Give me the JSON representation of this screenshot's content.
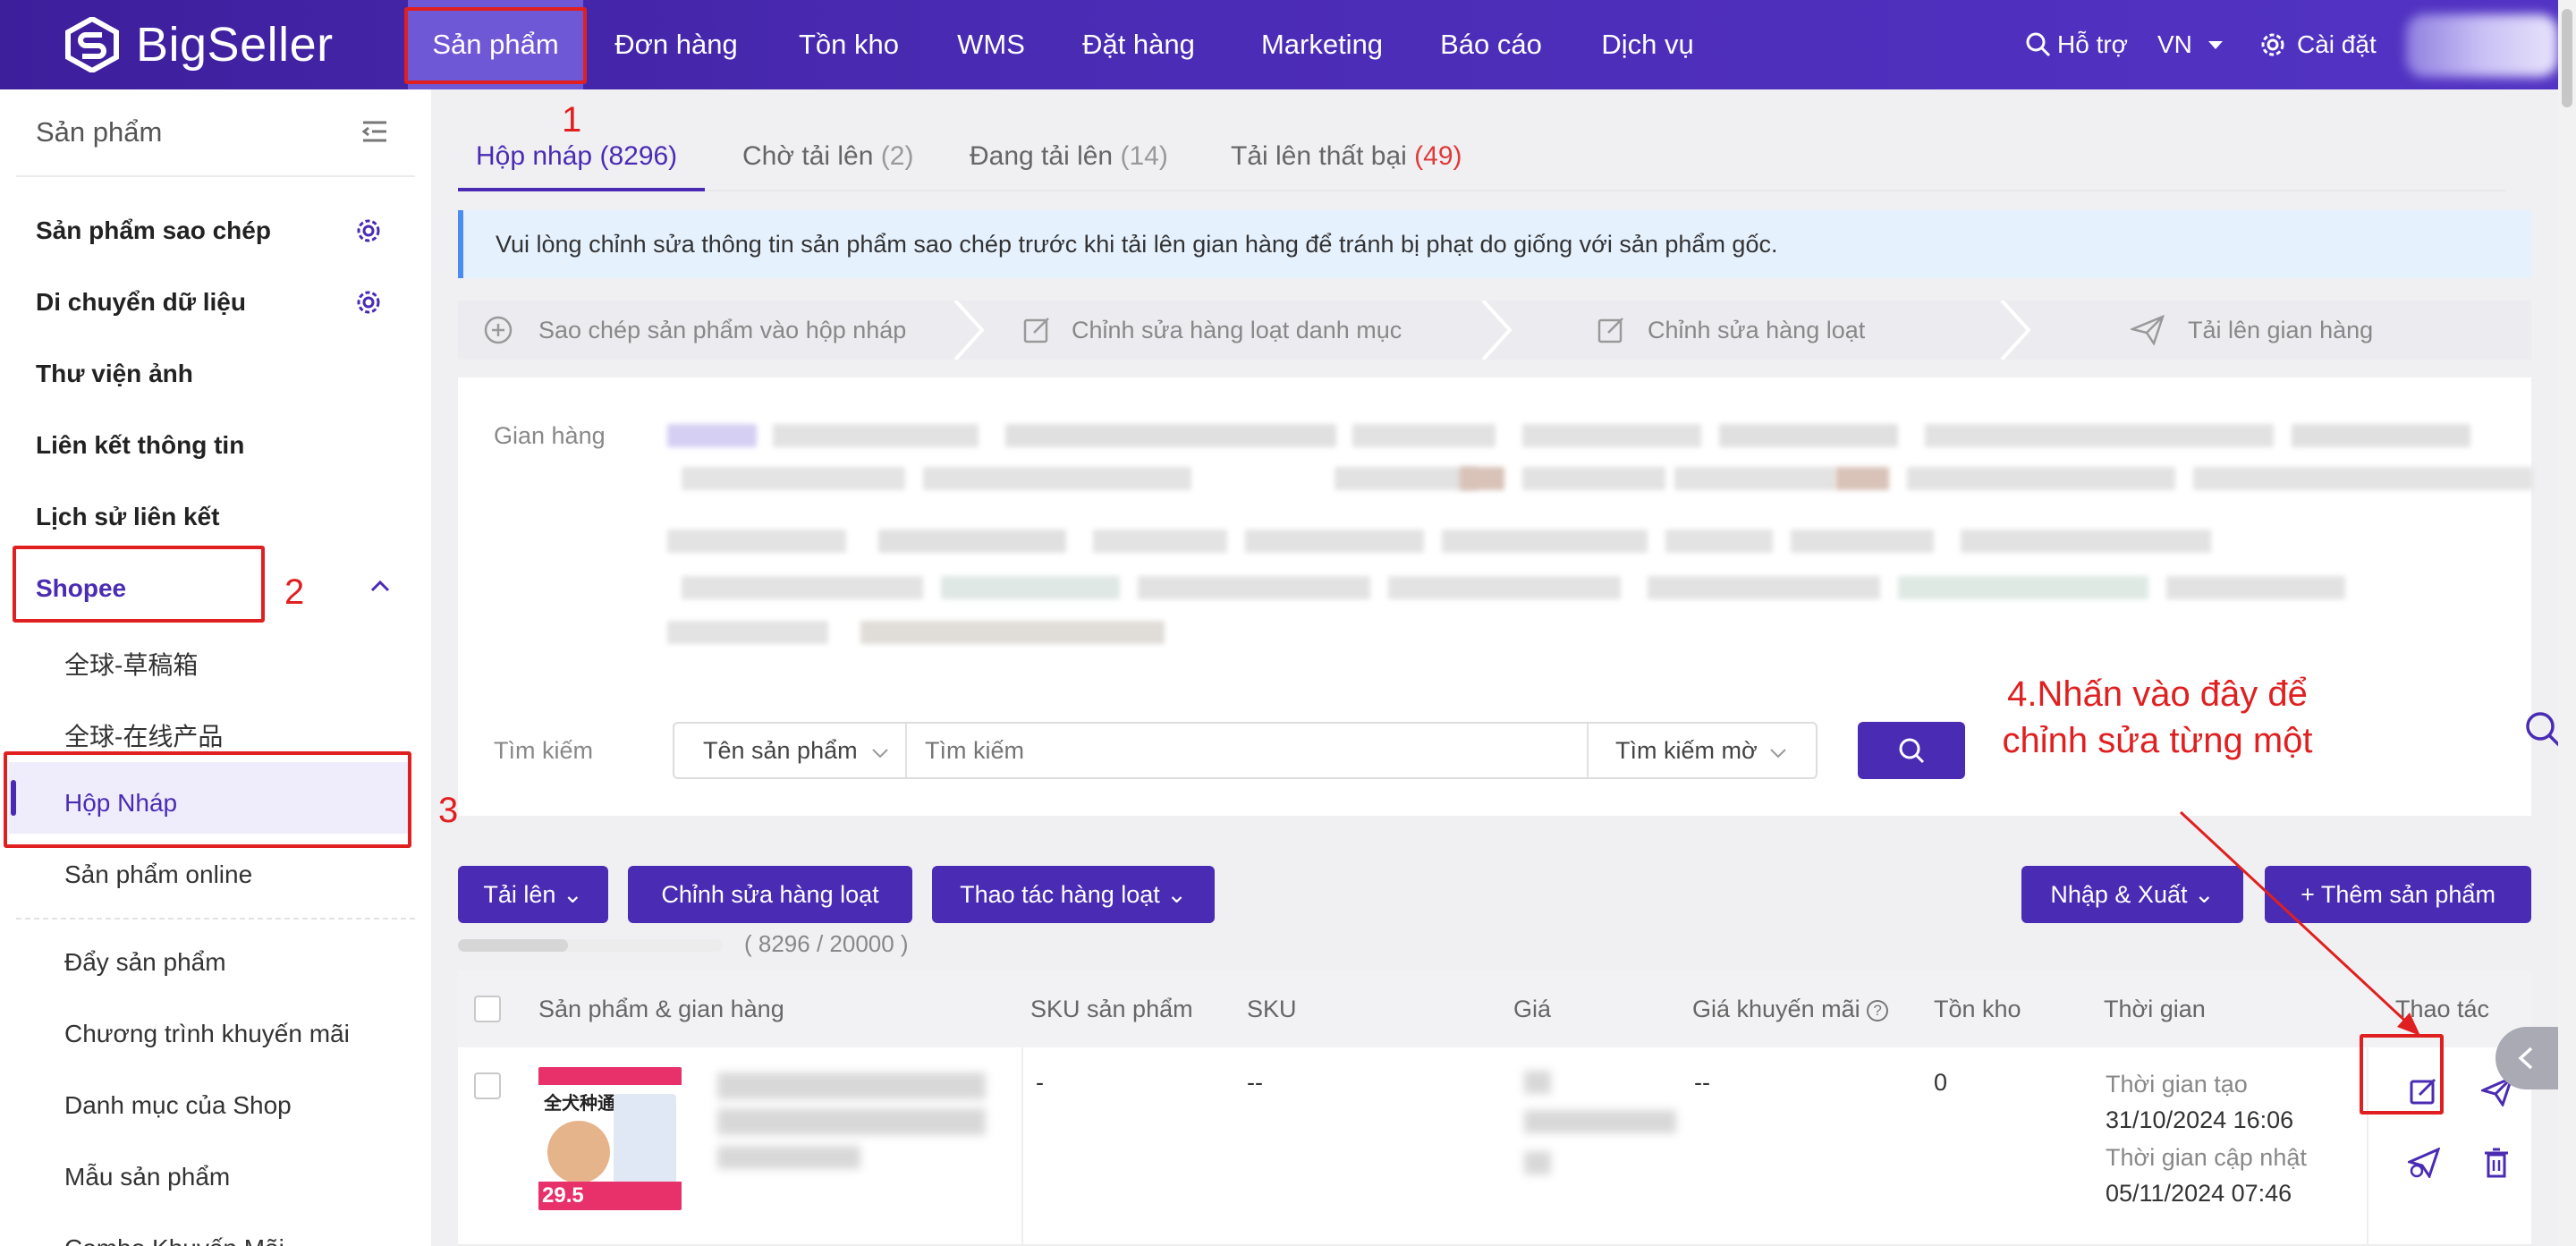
{
  "brand": {
    "name": "BigSeller"
  },
  "nav": {
    "items": [
      "Sản phẩm",
      "Đơn hàng",
      "Tồn kho",
      "WMS",
      "Đặt hàng",
      "Marketing",
      "Báo cáo",
      "Dịch vụ"
    ],
    "active": "Sản phẩm",
    "support": "Hỗ trợ",
    "region": "VN",
    "settings": "Cài đặt"
  },
  "sidebar": {
    "header": "Sản phẩm",
    "items": [
      {
        "label": "Sản phẩm sao chép",
        "icon": "gear-icon"
      },
      {
        "label": "Di chuyển dữ liệu",
        "icon": "gear-icon"
      },
      {
        "label": "Thư viện ảnh"
      },
      {
        "label": "Liên kết thông tin"
      },
      {
        "label": "Lịch sử liên kết"
      }
    ],
    "section": {
      "label": "Shopee",
      "expanded": true
    },
    "sub_items": [
      "全球-草稿箱",
      "全球-在线产品",
      "Hộp Nháp",
      "Sản phẩm online"
    ],
    "active_sub": "Hộp Nháp",
    "more_items": [
      "Đẩy sản phẩm",
      "Chương trình khuyến mãi",
      "Danh mục của Shop",
      "Mẫu sản phẩm",
      "Combo Khuyến Mãi"
    ]
  },
  "annotations": {
    "n1": "1",
    "n2": "2",
    "n3": "3",
    "n4_line1": "4.Nhấn vào đây để",
    "n4_line2": "chỉnh sửa từng một"
  },
  "tabs": [
    {
      "label": "Hộp nháp",
      "count": "(8296)"
    },
    {
      "label": "Chờ tải lên",
      "count": "(2)"
    },
    {
      "label": "Đang tải lên",
      "count": "(14)"
    },
    {
      "label": "Tải lên thất bại",
      "count": "(49)"
    }
  ],
  "notice": "Vui lòng chỉnh sửa thông tin sản phẩm sao chép trước khi tải lên gian hàng để tránh bị phạt do giống với sản phẩm gốc.",
  "steps": [
    "Sao chép sản phẩm vào hộp nháp",
    "Chỉnh sửa hàng loạt danh mục",
    "Chỉnh sửa hàng loạt",
    "Tải lên gian hàng"
  ],
  "filter": {
    "store_label": "Gian hàng",
    "search_label": "Tìm kiếm",
    "search_field": "Tên sản phẩm",
    "search_placeholder": "Tìm kiếm",
    "search_mode": "Tìm kiếm mờ"
  },
  "toolbar": {
    "upload": "Tải lên",
    "bulk_edit": "Chỉnh sửa hàng loạt",
    "bulk_action": "Thao tác hàng loạt",
    "import_export": "Nhập & Xuất",
    "add_product": "+ Thêm sản phẩm"
  },
  "quota": {
    "text": "( 8296 / 20000 )",
    "used": 8296,
    "total": 20000
  },
  "table": {
    "columns": [
      "Sản phẩm & gian hàng",
      "SKU sản phẩm",
      "SKU",
      "Giá",
      "Giá khuyến mãi",
      "Tồn kho",
      "Thời gian",
      "Thao tác"
    ],
    "rows": [
      {
        "product_sku": "-",
        "sku": "--",
        "promo_price": "--",
        "stock": "0",
        "created_label": "Thời gian tạo",
        "created": "31/10/2024 16:06",
        "updated_label": "Thời gian cập nhật",
        "updated": "05/11/2024 07:46",
        "image_text": {
          "headline": "全犬种通用",
          "price": "29.5"
        }
      }
    ]
  },
  "colors": {
    "brand": "#4a2bb4",
    "annotation": "#e02020",
    "failed_count": "#e03a3a"
  }
}
